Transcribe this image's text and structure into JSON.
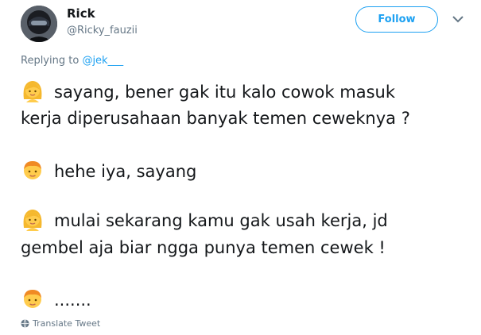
{
  "tweet": {
    "user": {
      "name": "Rick",
      "handle": "@Ricky_fauzii"
    },
    "follow_label": "Follow",
    "reply": {
      "prefix": "Replying to",
      "mention": "@jek___"
    },
    "lines": [
      "sayang, bener gak itu kalo cowok masuk",
      "kerja diperusahaan banyak temen ceweknya ?",
      "hehe iya, sayang",
      "mulai sekarang kamu gak usah kerja, jd",
      "gembel aja biar ngga punya temen cewek !",
      "......."
    ],
    "icons": {
      "girl": "woman-emoji-icon",
      "boy": "boy-emoji-icon",
      "globe": "globe-icon",
      "chevron": "chevron-down-icon"
    },
    "translate_label": "Translate Tweet",
    "colors": {
      "accent": "#1da1f2",
      "muted": "#657786",
      "text": "#14171a"
    }
  }
}
